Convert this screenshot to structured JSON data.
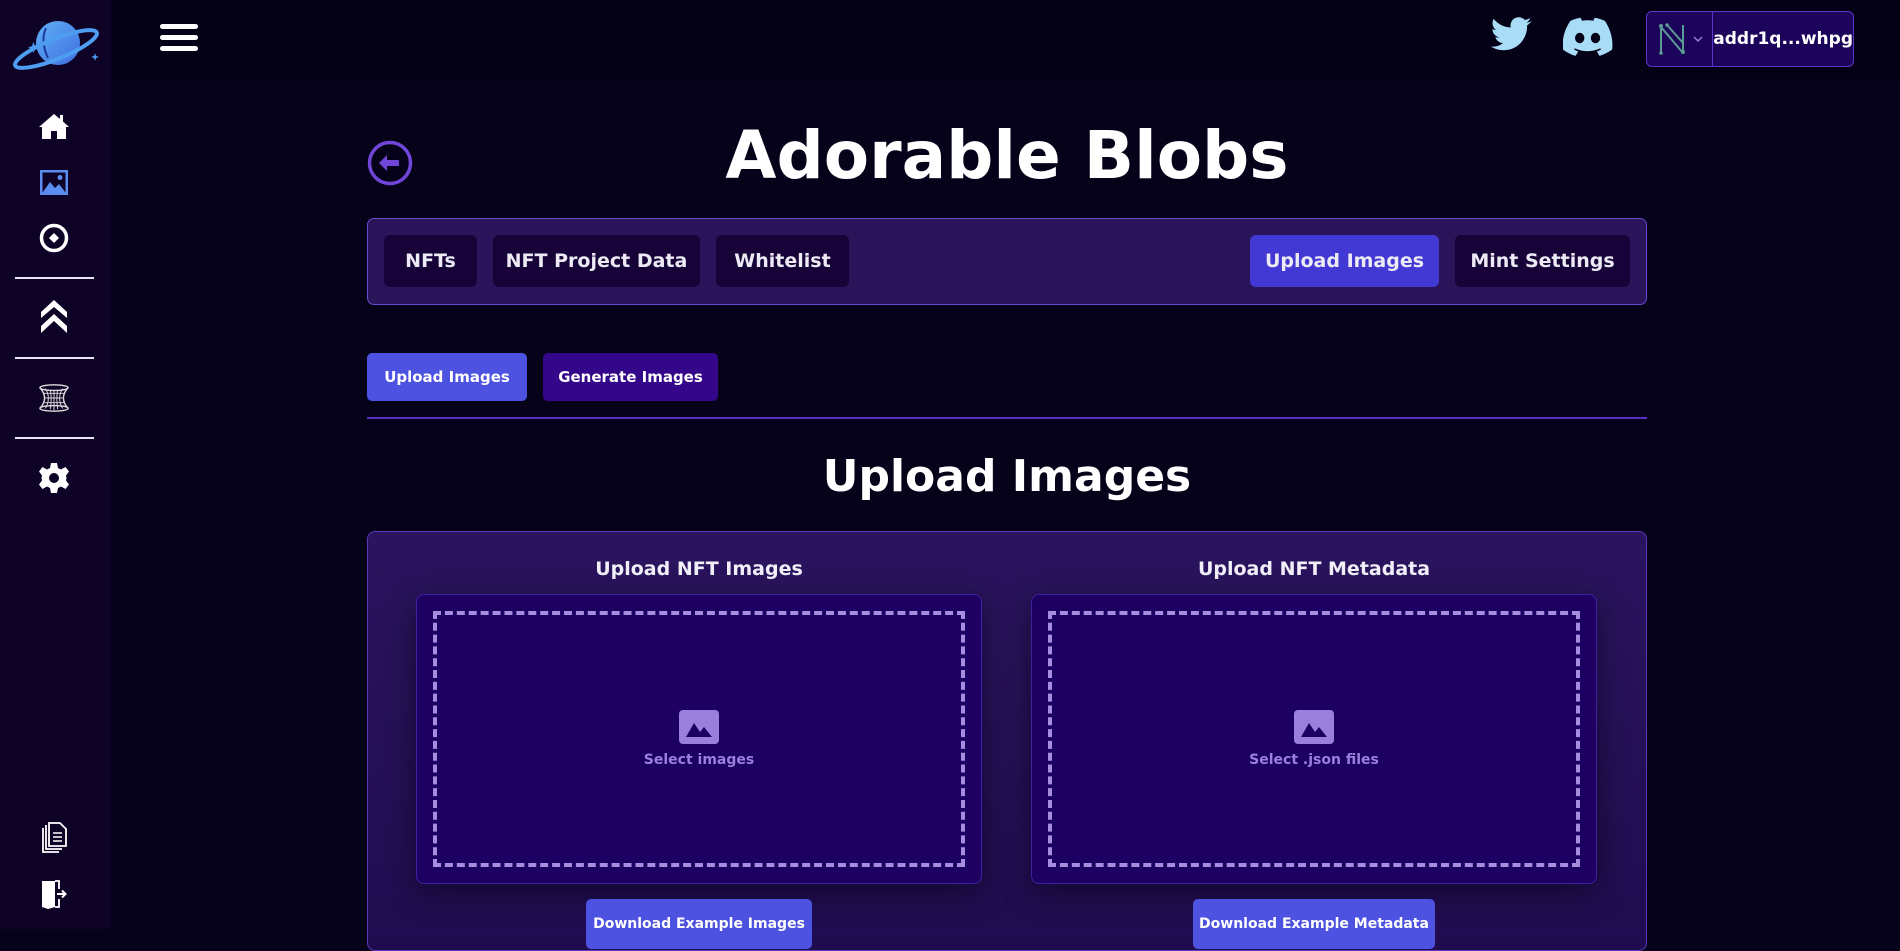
{
  "sidebar": {
    "logo": "planet-logo",
    "items": [
      {
        "name": "home",
        "icon": "home-icon"
      },
      {
        "name": "nft-gallery",
        "icon": "image-icon",
        "active": true
      },
      {
        "name": "token",
        "icon": "token-icon"
      },
      {
        "name": "staking",
        "icon": "chevrons-up-icon"
      },
      {
        "name": "wormhole",
        "icon": "wormhole-icon"
      },
      {
        "name": "settings",
        "icon": "gear-icon"
      }
    ],
    "bottom_items": [
      {
        "name": "docs",
        "icon": "documents-icon"
      },
      {
        "name": "logout",
        "icon": "logout-icon"
      }
    ]
  },
  "topbar": {
    "social": [
      "twitter",
      "discord"
    ],
    "wallet": {
      "address": "addr1q...whpg",
      "provider_icon": "nami-wallet-icon"
    }
  },
  "page": {
    "title": "Adorable Blobs",
    "tabs": [
      {
        "label": "NFTs",
        "active": false
      },
      {
        "label": "NFT Project Data",
        "active": false
      },
      {
        "label": "Whitelist",
        "active": false
      },
      {
        "label": "Upload Images",
        "active": true
      },
      {
        "label": "Mint Settings",
        "active": false
      }
    ],
    "sub_tabs": [
      {
        "label": "Upload Images",
        "active": true
      },
      {
        "label": "Generate Images",
        "active": false
      }
    ],
    "section_title": "Upload Images",
    "upload_columns": [
      {
        "title": "Upload NFT Images",
        "dropzone_label": "Select images",
        "download_label": "Download Example Images"
      },
      {
        "title": "Upload NFT Metadata",
        "dropzone_label": "Select .json files",
        "download_label": "Download Example Metadata"
      }
    ]
  },
  "colors": {
    "accent": "#4238d4",
    "sidebar_bg": "#0e0226",
    "panel_bg": "#2a145a",
    "twitter": "#a9dcf7"
  }
}
